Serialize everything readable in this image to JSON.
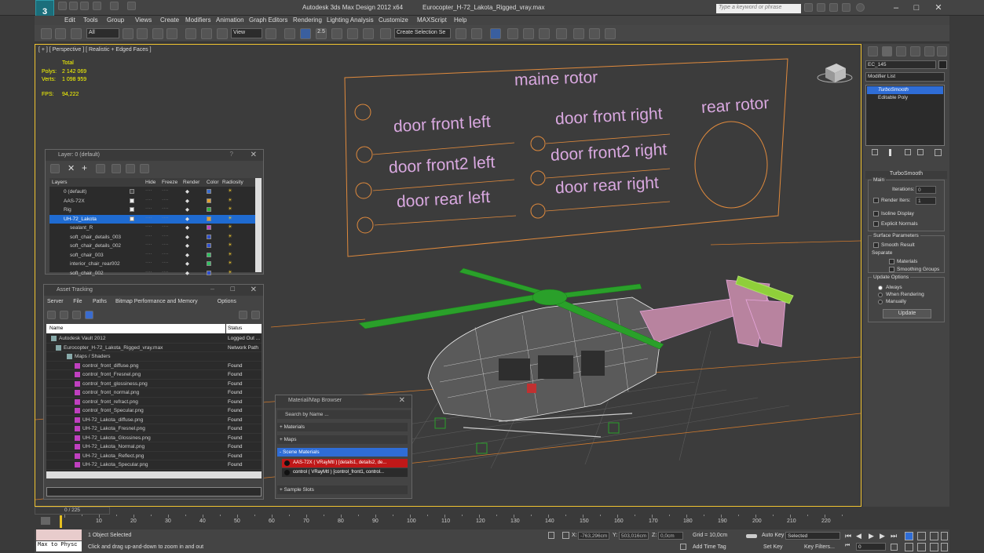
{
  "window": {
    "app_title": "Autodesk 3ds Max Design 2012 x64",
    "file_title": "Eurocopter_H-72_Lakota_Rigged_vray.max",
    "search_placeholder": "Type a keyword or phrase"
  },
  "menu": [
    "Edit",
    "Tools",
    "Group",
    "Views",
    "Create",
    "Modifiers",
    "Animation",
    "Graph Editors",
    "Rendering",
    "Lighting Analysis",
    "Customize",
    "MAXScript",
    "Help"
  ],
  "toolbar": {
    "selection_filter": "All",
    "reference_coord": "View",
    "named_selection": "Create Selection Se",
    "snap_value": "2.5"
  },
  "viewport": {
    "label": "[ + ] [ Perspective ] [ Realistic + Edged Faces ]",
    "stats_total": "Total",
    "polys_label": "Polys:",
    "polys_value": "2 142 069",
    "verts_label": "Verts:",
    "verts_value": "1 098 959",
    "fps_label": "FPS:",
    "fps_value": "94,222",
    "template_labels": {
      "title": "maine rotor",
      "door_front_left": "door front left",
      "door_front2_left": "door front2 left",
      "door_rear_left": "door rear left",
      "door_front_right": "door front right",
      "door_front2_right": "door front2 right",
      "door_rear_right": "door rear right",
      "rear_rotor": "rear rotor"
    }
  },
  "layer_panel": {
    "title": "Layer: 0 (default)",
    "columns": [
      "Layers",
      "Hide",
      "Freeze",
      "Render",
      "Color",
      "Radiosity"
    ],
    "rows": [
      {
        "name": "0 (default)",
        "color": "#3a6ccf",
        "check": true
      },
      {
        "name": "AAS-72X",
        "color": "#e0a030"
      },
      {
        "name": "Rig",
        "color": "#30b040"
      },
      {
        "name": "UH-72_Lakota",
        "color": "#e0a030",
        "selected": true
      },
      {
        "name": "sealant_R",
        "color": "#c040c0"
      },
      {
        "name": "soft_chair_details_003",
        "color": "#3050d0"
      },
      {
        "name": "soft_chair_details_002",
        "color": "#3050d0"
      },
      {
        "name": "soft_chair_003",
        "color": "#30c060"
      },
      {
        "name": "interior_chair_rear002",
        "color": "#30c060"
      },
      {
        "name": "soft_chair_002",
        "color": "#3050d0"
      }
    ]
  },
  "asset_panel": {
    "title": "Asset Tracking",
    "menu": [
      "Server",
      "File",
      "Paths",
      "Bitmap Performance and Memory",
      "Options"
    ],
    "col_name": "Name",
    "col_status": "Status",
    "rows": [
      {
        "name": "Autodesk Vault 2012",
        "status": "Logged Out ...",
        "indent": 0
      },
      {
        "name": "Eurocopter_H-72_Lakota_Rigged_vray.max",
        "status": "Network Path",
        "indent": 1
      },
      {
        "name": "Maps / Shaders",
        "status": "",
        "indent": 2
      },
      {
        "name": "control_front_diffuse.png",
        "status": "Found",
        "indent": 3
      },
      {
        "name": "control_front_Fresnel.png",
        "status": "Found",
        "indent": 3
      },
      {
        "name": "control_front_glossiness.png",
        "status": "Found",
        "indent": 3
      },
      {
        "name": "control_front_normal.png",
        "status": "Found",
        "indent": 3
      },
      {
        "name": "control_front_refract.png",
        "status": "Found",
        "indent": 3
      },
      {
        "name": "control_front_Specular.png",
        "status": "Found",
        "indent": 3
      },
      {
        "name": "UH-72_Lakota_diffuse.png",
        "status": "Found",
        "indent": 3
      },
      {
        "name": "UH-72_Lakota_Fresnel.png",
        "status": "Found",
        "indent": 3
      },
      {
        "name": "UH-72_Lakota_Glossines.png",
        "status": "Found",
        "indent": 3
      },
      {
        "name": "UH-72_Lakota_Normal.png",
        "status": "Found",
        "indent": 3
      },
      {
        "name": "UH-72_Lakota_Reflect.png",
        "status": "Found",
        "indent": 3
      },
      {
        "name": "UH-72_Lakota_Specular.png",
        "status": "Found",
        "indent": 3
      }
    ]
  },
  "material_browser": {
    "title": "Material/Map Browser",
    "search_placeholder": "Search by Name ...",
    "sections": [
      "+ Materials",
      "+ Maps",
      "- Scene Materials",
      "+ Sample Slots"
    ],
    "scene_materials": [
      "AAS-72X ( VRayMtl ) [details1, details2, de...",
      "control ( VRayMtl ) [control_front1, control..."
    ]
  },
  "command_panel": {
    "object_name": "EC_145",
    "modifier_list": "Modifier List",
    "stack": [
      "TurboSmooth",
      "Editable Poly"
    ],
    "rollout_title": "TurboSmooth",
    "main_label": "Main",
    "iterations_label": "Iterations:",
    "iterations_value": "0",
    "render_iters_label": "Render Iters:",
    "render_iters_value": "1",
    "isoline_label": "Isoline Display",
    "explicit_label": "Explicit Normals",
    "surface_label": "Surface Parameters",
    "smooth_result_label": "Smooth Result",
    "separate_label": "Separate",
    "materials_label": "Materials",
    "smoothing_groups_label": "Smoothing Groups",
    "update_options_label": "Update Options",
    "always_label": "Always",
    "when_rendering_label": "When Rendering",
    "manually_label": "Manually",
    "update_button": "Update"
  },
  "timeline": {
    "frame_display": "0 / 225",
    "ticks": [
      "10",
      "20",
      "30",
      "40",
      "50",
      "60",
      "70",
      "80",
      "90",
      "100",
      "110",
      "120",
      "130",
      "140",
      "150",
      "160",
      "170",
      "180",
      "190",
      "200",
      "210",
      "220"
    ]
  },
  "status": {
    "script_label": "Max to Physc",
    "selected_text": "1 Object Selected",
    "prompt_text": "Click and drag up-and-down to zoom in and out",
    "x_label": "X:",
    "x_value": "-763,296cm",
    "y_label": "Y:",
    "y_value": "503,016cm",
    "z_label": "Z:",
    "z_value": "0,0cm",
    "grid_text": "Grid = 10,0cm",
    "add_time_tag": "Add Time Tag",
    "auto_key": "Auto Key",
    "auto_key_value": "Selected",
    "set_key": "Set Key",
    "key_filters": "Key Filters...",
    "frame_value": "0"
  }
}
